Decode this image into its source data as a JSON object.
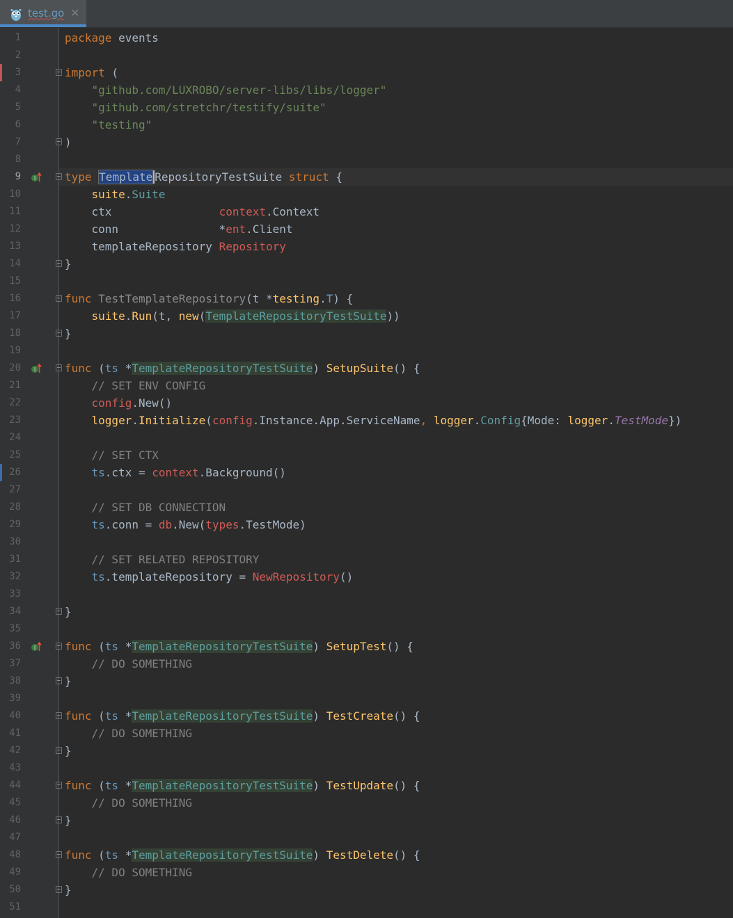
{
  "tab": {
    "filename": "test.go",
    "close_glyph": "✕",
    "icon": "gopher-icon"
  },
  "active_line": 9,
  "lines": [
    {
      "n": "1",
      "html": "<span class=\"k\">package</span> events"
    },
    {
      "n": "2",
      "html": ""
    },
    {
      "n": "3",
      "html": "<span class=\"k\">import</span> (",
      "fold": true,
      "marker": "red"
    },
    {
      "n": "4",
      "html": "    <span class=\"s\">\"github.com/LUXROBO/server-libs/libs/logger\"</span>"
    },
    {
      "n": "5",
      "html": "    <span class=\"s\">\"github.com/stretchr/testify/suite\"</span>"
    },
    {
      "n": "6",
      "html": "    <span class=\"s\">\"testing\"</span>"
    },
    {
      "n": "7",
      "html": ")",
      "fold": true
    },
    {
      "n": "8",
      "html": ""
    },
    {
      "n": "9",
      "html": "<span class=\"k\">type</span> <span class=\"sel\">Template</span><span class=\"caret\"></span>RepositoryTestSuite <span class=\"k\">struct</span> {",
      "fold": true,
      "impl": true
    },
    {
      "n": "10",
      "html": "    <span class=\"fn\">suite</span>.<span class=\"t\">Suite</span>"
    },
    {
      "n": "11",
      "html": "    ctx                <span class=\"r\">context</span>.Context"
    },
    {
      "n": "12",
      "html": "    conn               *<span class=\"r\">ent</span>.Client"
    },
    {
      "n": "13",
      "html": "    templateRepository <span class=\"r\">Repository</span>"
    },
    {
      "n": "14",
      "html": "}",
      "fold": true
    },
    {
      "n": "15",
      "html": ""
    },
    {
      "n": "16",
      "html": "<span class=\"k\">func</span> <span class=\"gr\">TestTemplateRepository</span>(t *<span class=\"fn\">testing</span>.<span class=\"p\">T</span>) {",
      "fold": true
    },
    {
      "n": "17",
      "html": "    <span class=\"fn\">suite</span>.<span class=\"fn\">Run</span>(t, <span class=\"fn\">new</span>(<span class=\"t hl\">TemplateRepositoryTestSuite</span>))"
    },
    {
      "n": "18",
      "html": "}",
      "fold": true
    },
    {
      "n": "19",
      "html": ""
    },
    {
      "n": "20",
      "html": "<span class=\"k\">func</span> (<span class=\"p\">ts</span> *<span class=\"t hl\">TemplateRepositoryTestSuite</span>) <span class=\"fn\">SetupSuite</span>() {",
      "fold": true,
      "impl": true
    },
    {
      "n": "21",
      "html": "    <span class=\"c\">// SET ENV CONFIG</span>"
    },
    {
      "n": "22",
      "html": "    <span class=\"r\">config</span>.New()"
    },
    {
      "n": "23",
      "html": "    <span class=\"fn\">logger</span>.<span class=\"fn\">Initialize</span>(<span class=\"r\">config</span>.Instance.App.ServiceName<span class=\"k\">,</span> <span class=\"fn\">logger</span>.<span class=\"t\">Config</span>{Mode: <span class=\"fn\">logger</span>.<span class=\"tv\">TestMode</span>})"
    },
    {
      "n": "24",
      "html": ""
    },
    {
      "n": "25",
      "html": "    <span class=\"c\">// SET CTX</span>"
    },
    {
      "n": "26",
      "html": "    <span class=\"p\">ts</span>.ctx = <span class=\"r\">context</span>.Background()",
      "marker": "blue"
    },
    {
      "n": "27",
      "html": ""
    },
    {
      "n": "28",
      "html": "    <span class=\"c\">// SET DB CONNECTION</span>"
    },
    {
      "n": "29",
      "html": "    <span class=\"p\">ts</span>.conn = <span class=\"r\">db</span>.New(<span class=\"r\">types</span>.TestMode)"
    },
    {
      "n": "30",
      "html": ""
    },
    {
      "n": "31",
      "html": "    <span class=\"c\">// SET RELATED REPOSITORY</span>"
    },
    {
      "n": "32",
      "html": "    <span class=\"p\">ts</span>.templateRepository = <span class=\"r\">NewRepository</span>()"
    },
    {
      "n": "33",
      "html": ""
    },
    {
      "n": "34",
      "html": "}",
      "fold": true
    },
    {
      "n": "35",
      "html": ""
    },
    {
      "n": "36",
      "html": "<span class=\"k\">func</span> (<span class=\"p\">ts</span> *<span class=\"t hl\">TemplateRepositoryTestSuite</span>) <span class=\"fn\">SetupTest</span>() {",
      "fold": true,
      "impl": true
    },
    {
      "n": "37",
      "html": "    <span class=\"c\">// DO SOMETHING</span>"
    },
    {
      "n": "38",
      "html": "}",
      "fold": true
    },
    {
      "n": "39",
      "html": ""
    },
    {
      "n": "40",
      "html": "<span class=\"k\">func</span> (<span class=\"p\">ts</span> *<span class=\"t hl\">TemplateRepositoryTestSuite</span>) <span class=\"fn\">TestCreate</span>() {",
      "fold": true
    },
    {
      "n": "41",
      "html": "    <span class=\"c\">// DO SOMETHING</span>"
    },
    {
      "n": "42",
      "html": "}",
      "fold": true
    },
    {
      "n": "43",
      "html": ""
    },
    {
      "n": "44",
      "html": "<span class=\"k\">func</span> (<span class=\"p\">ts</span> *<span class=\"t hl\">TemplateRepositoryTestSuite</span>) <span class=\"fn\">TestUpdate</span>() {",
      "fold": true
    },
    {
      "n": "45",
      "html": "    <span class=\"c\">// DO SOMETHING</span>"
    },
    {
      "n": "46",
      "html": "}",
      "fold": true
    },
    {
      "n": "47",
      "html": ""
    },
    {
      "n": "48",
      "html": "<span class=\"k\">func</span> (<span class=\"p\">ts</span> *<span class=\"t hl\">TemplateRepositoryTestSuite</span>) <span class=\"fn\">TestDelete</span>() {",
      "fold": true
    },
    {
      "n": "49",
      "html": "    <span class=\"c\">// DO SOMETHING</span>"
    },
    {
      "n": "50",
      "html": "}",
      "fold": true
    },
    {
      "n": "51",
      "html": ""
    }
  ]
}
